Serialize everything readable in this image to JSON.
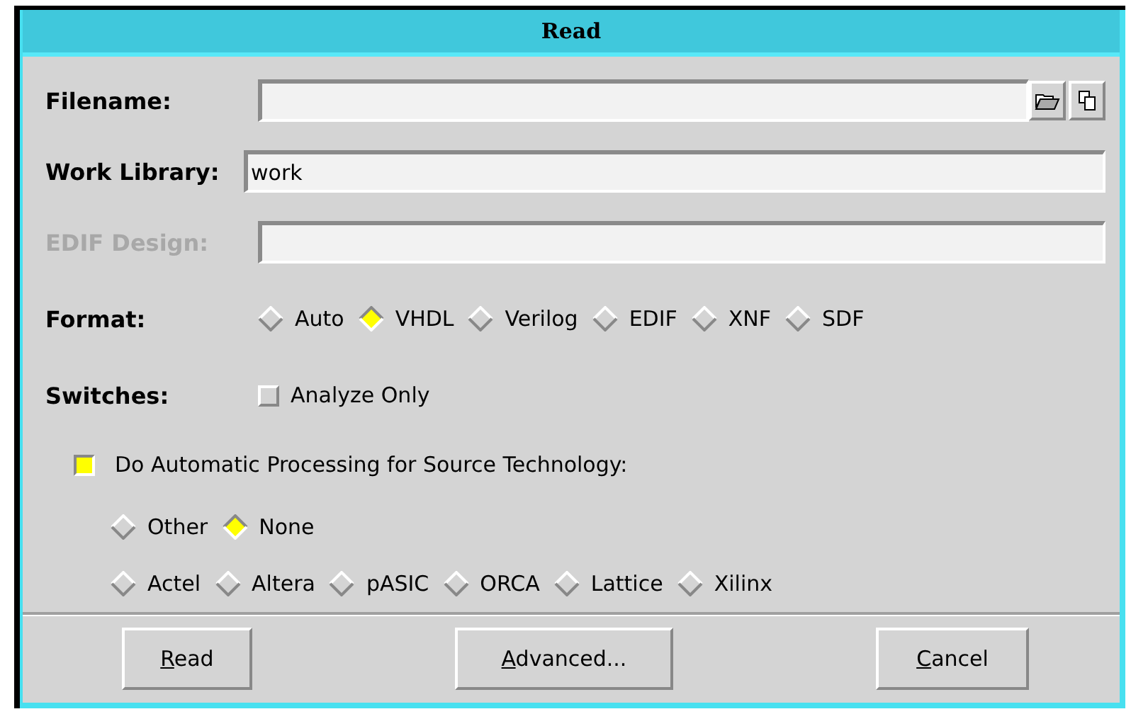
{
  "window": {
    "title": "Read"
  },
  "fields": [
    {
      "label": "Filename:",
      "disabled": false,
      "kind": "file"
    },
    {
      "label": "Work Library:",
      "value": "work",
      "disabled": false,
      "kind": "text"
    },
    {
      "label": "EDIF Design:",
      "disabled": true,
      "kind": "text"
    }
  ],
  "format": {
    "label": "Format:",
    "options": [
      {
        "label": "Auto",
        "selected": false
      },
      {
        "label": "VHDL",
        "selected": true
      },
      {
        "label": "Verilog",
        "selected": false
      },
      {
        "label": "EDIF",
        "selected": false
      },
      {
        "label": "XNF",
        "selected": false
      },
      {
        "label": "SDF",
        "selected": false
      }
    ]
  },
  "switches": {
    "label": "Switches:",
    "options": [
      {
        "label": "Analyze Only",
        "checked": false
      }
    ]
  },
  "auto_processing": {
    "label": "Do Automatic Processing for Source Technology:",
    "checked": true,
    "rows": [
      [
        {
          "label": "Other",
          "selected": false
        },
        {
          "label": "None",
          "selected": true
        }
      ],
      [
        {
          "label": "Actel",
          "selected": false
        },
        {
          "label": "Altera",
          "selected": false
        },
        {
          "label": "pASIC",
          "selected": false
        },
        {
          "label": "ORCA",
          "selected": false
        },
        {
          "label": "Lattice",
          "selected": false
        },
        {
          "label": "Xilinx",
          "selected": false
        }
      ]
    ]
  },
  "buttons": [
    {
      "mnemonic": "R",
      "rest": "ead"
    },
    {
      "mnemonic": "A",
      "rest": "dvanced..."
    },
    {
      "mnemonic": "C",
      "rest": "ancel"
    }
  ]
}
